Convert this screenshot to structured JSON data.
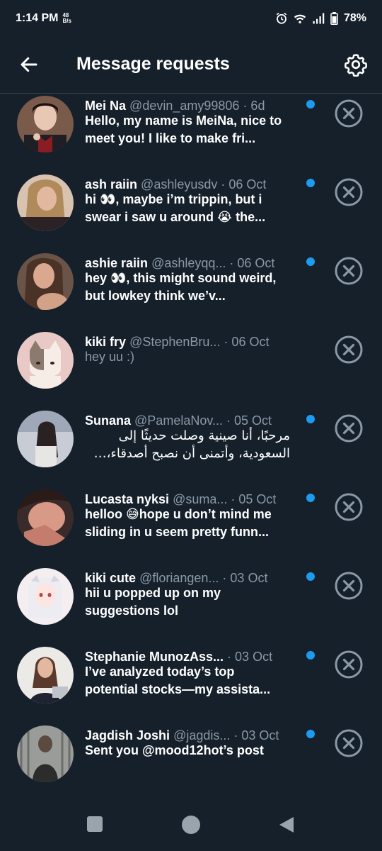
{
  "status": {
    "time": "1:14 PM",
    "net_speed_value": "48",
    "net_speed_unit": "B/s",
    "battery": "78%"
  },
  "header": {
    "title": "Message requests"
  },
  "colors": {
    "background": "#15202b",
    "accent": "#1d9bf0",
    "muted": "#8b98a5",
    "divider": "#38444d"
  },
  "requests": [
    {
      "name": "Mei Na",
      "handle": "@devin_amy99806",
      "date": "· 6d",
      "message": "Hello, my name is MeiNa, nice to meet you! I like to make fri...",
      "unread": true
    },
    {
      "name": "ash raiin",
      "handle": "@ashleyusdv",
      "date": "· 06 Oct",
      "message": "hi 👀, maybe i’m trippin, but i swear i saw u around 😭 the...",
      "unread": true
    },
    {
      "name": "ashie raiin",
      "handle": "@ashleyqq...",
      "date": "· 06 Oct",
      "message": "hey 👀, this might sound weird, but lowkey think we’v...",
      "unread": true
    },
    {
      "name": "kiki fry",
      "handle": "@StephenBru...",
      "date": "· 06 Oct",
      "message": "hey uu :)",
      "unread": false
    },
    {
      "name": "Sunana",
      "handle": "@PamelaNov...",
      "date": "· 05 Oct",
      "message": "مرحبًا، أنا صينية وصلت حديثًا إلى السعودية، وأتمنى أن نصبح أصدقاء، وأ...",
      "unread": true
    },
    {
      "name": "Lucasta nyksi",
      "handle": "@suma...",
      "date": "· 05 Oct",
      "message": "helloo 😅hope u don’t mind me sliding in u seem pretty funn...",
      "unread": true
    },
    {
      "name": "kiki cute",
      "handle": "@floriangen...",
      "date": "· 03 Oct",
      "message": "hii u popped up on my suggestions lol",
      "unread": true
    },
    {
      "name": "Stephanie MunozAss...",
      "handle": "",
      "date": "· 03 Oct",
      "message": "I’ve analyzed today’s top potential stocks—my assista...",
      "unread": true
    },
    {
      "name": "Jagdish Joshi",
      "handle": "@jagdis...",
      "date": "· 03 Oct",
      "message": "Sent you @mood12hot’s post",
      "unread": true
    }
  ]
}
